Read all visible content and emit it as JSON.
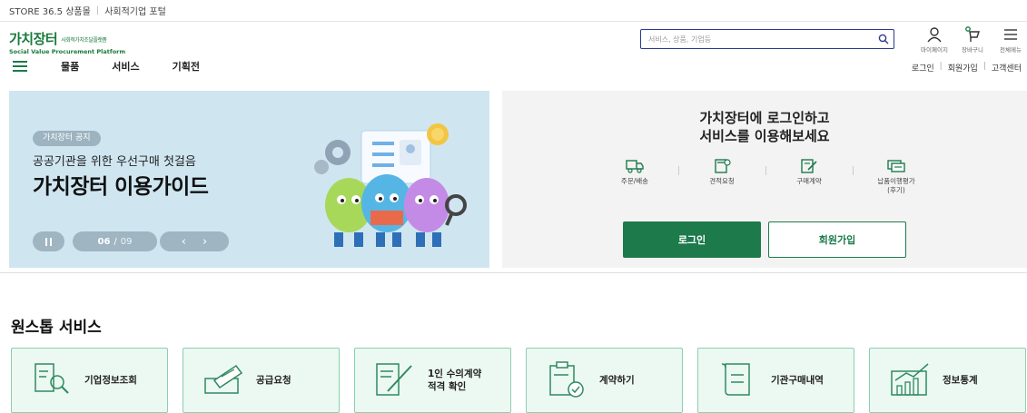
{
  "topbar": {
    "store_link": "STORE 36.5 상품몰",
    "portal_link": "사회적기업 포털"
  },
  "logo": {
    "name": "가치장터",
    "sub_kor": "사회적가치조달플랫폼",
    "sub_en": "Social Value Procurement Platform"
  },
  "search": {
    "placeholder": "서비스, 상품, 기업등"
  },
  "header_icons": [
    {
      "label": "마이페이지",
      "icon": "user-icon"
    },
    {
      "label": "장바구니",
      "icon": "cart-icon"
    },
    {
      "label": "전체메뉴",
      "icon": "menu-icon"
    }
  ],
  "nav": {
    "items": [
      "물품",
      "서비스",
      "기획전"
    ]
  },
  "utility": {
    "login": "로그인",
    "signup": "회원가입",
    "support": "고객센터"
  },
  "banner": {
    "tag": "가치장터 공지",
    "subtitle": "공공기관을 위한 우선구매 첫걸음",
    "title": "가치장터 이용가이드",
    "current": "06",
    "separator": "/",
    "total": "09"
  },
  "login_panel": {
    "title_line1": "가치장터에 로그인하고",
    "title_line2": "서비스를 이용해보세요",
    "quick_links": [
      {
        "label": "주문/배송",
        "icon": "truck-icon"
      },
      {
        "label": "견적요청",
        "icon": "calculator-icon"
      },
      {
        "label": "구매계약",
        "icon": "contract-icon"
      },
      {
        "label": "납품이행평가\n(후기)",
        "icon": "review-icon"
      }
    ],
    "login_button": "로그인",
    "signup_button": "회원가입"
  },
  "onestop": {
    "title": "원스톱 서비스",
    "cards": [
      {
        "label": "기업정보조회",
        "icon": "company-search-icon"
      },
      {
        "label": "공급요청",
        "icon": "supply-request-icon"
      },
      {
        "label": "1인 수의계약\n적격 확인",
        "icon": "contract-check-icon"
      },
      {
        "label": "계약하기",
        "icon": "clipboard-check-icon"
      },
      {
        "label": "기관구매내역",
        "icon": "scroll-icon"
      },
      {
        "label": "정보통계",
        "icon": "stats-icon"
      }
    ]
  },
  "colors": {
    "brand_green": "#1c7a4b",
    "banner_bg": "#cfe6f1",
    "card_bg": "#ecf8f2"
  }
}
